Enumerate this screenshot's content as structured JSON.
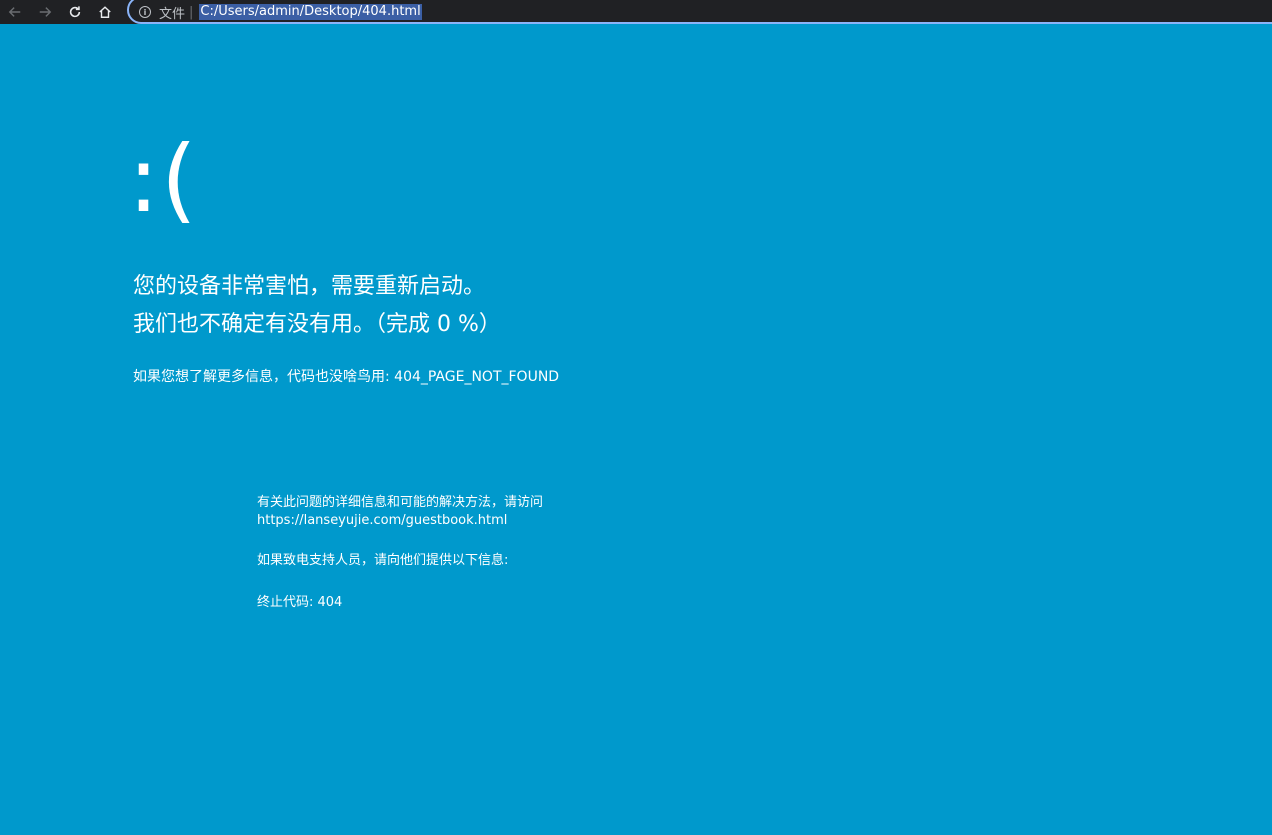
{
  "browser": {
    "scheme_label": "文件",
    "separator": "|",
    "url": "C:/Users/admin/Desktop/404.html",
    "icons": [
      "back-icon",
      "forward-icon",
      "reload-icon",
      "home-icon",
      "info-icon"
    ]
  },
  "bsod": {
    "background_color": "#0099cc",
    "sad_face": ":(",
    "line1": "您的设备非常害怕，需要重新启动。",
    "line2": "我们也不确定有没有用。（完成 0 %）",
    "info": "如果您想了解更多信息，代码也没啥鸟用: 404_PAGE_NOT_FOUND",
    "details_line1": "有关此问题的详细信息和可能的解决方法，请访问",
    "details_url": "https://lanseyujie.com/guestbook.html",
    "support": "如果致电支持人员，请向他们提供以下信息:",
    "stop_code": "终止代码: 404"
  }
}
